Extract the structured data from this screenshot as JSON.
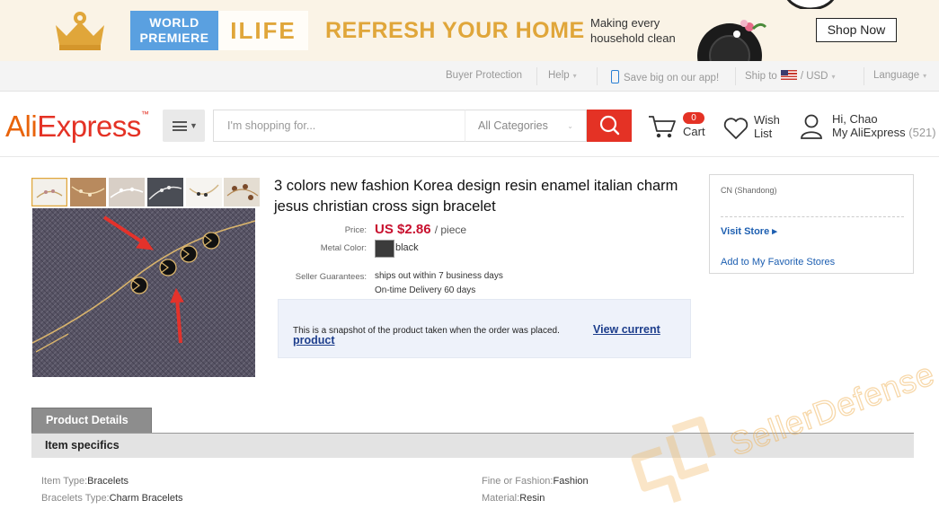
{
  "banner": {
    "world_premiere": "WORLD PREMIERE",
    "brand": "ILIFE",
    "headline": "REFRESH YOUR HOME",
    "tagline": "Making every household clean",
    "shop_now": "Shop Now"
  },
  "topbar": {
    "buyer_protection": "Buyer Protection",
    "help": "Help",
    "app": "Save big on our app!",
    "ship_to": "Ship to",
    "currency": "/ USD",
    "language": "Language"
  },
  "header": {
    "logo_ali": "Ali",
    "logo_express": "Express",
    "logo_tm": "™",
    "search_placeholder": "I'm shopping for...",
    "search_category": "All Categories",
    "cart_count": "0",
    "cart_label": "Cart",
    "wish_line1": "Wish",
    "wish_line2": "List",
    "greeting": "Hi, Chao",
    "my_account": "My AliExpress",
    "account_count": "(521)"
  },
  "product": {
    "title": "3 colors new fashion Korea design resin enamel italian charm jesus christian cross sign bracelet",
    "price_label": "Price:",
    "price": "US $2.86",
    "per_unit": "/ piece",
    "color_label": "Metal Color:",
    "color_value": "black",
    "guarantee_label": "Seller Guarantees:",
    "guarantee_1": "ships out within 7 business days",
    "guarantee_2": "On-time Delivery 60 days",
    "snapshot_text": "This is a snapshot of the product taken when the order was placed.",
    "snapshot_link": "View current product"
  },
  "store": {
    "location": "CN (Shandong)",
    "visit": "Visit Store ▸",
    "favorite": "Add to My Favorite Stores"
  },
  "details": {
    "tab": "Product Details",
    "heading": "Item specifics",
    "specs": [
      {
        "k": "Item Type:",
        "v": "Bracelets"
      },
      {
        "k": "Bracelets Type:",
        "v": "Charm Bracelets"
      },
      {
        "k": "Fine or Fashion:",
        "v": "Fashion"
      },
      {
        "k": "Material:",
        "v": "Resin"
      }
    ]
  },
  "watermark": "SellerDefense",
  "colors": {
    "brand_red": "#e43225",
    "brand_orange": "#e8630a",
    "banner_gold": "#e0a63a",
    "price_red": "#c8102e",
    "link_blue": "#1d5fb1"
  }
}
